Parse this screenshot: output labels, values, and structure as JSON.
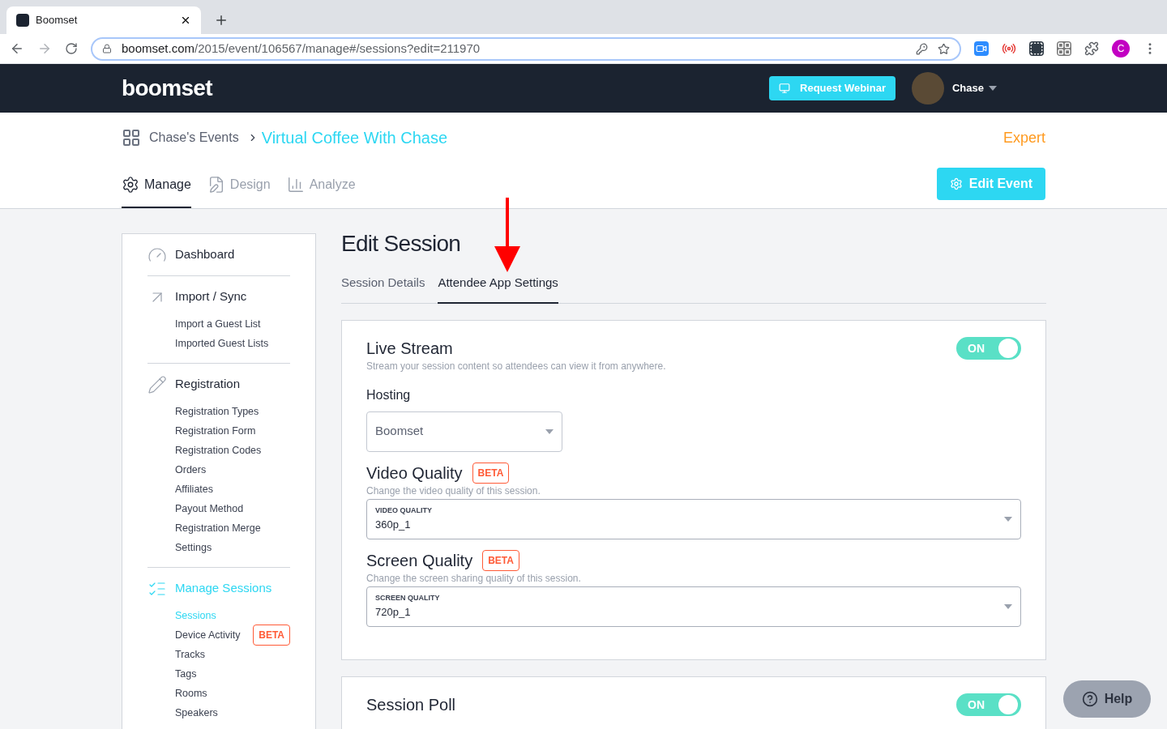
{
  "browser": {
    "tab_title": "Boomset",
    "url_host": "boomset.com",
    "url_path": "/2015/event/106567/manage#/sessions?edit=211970",
    "profile_initial": "C"
  },
  "navbar": {
    "logo": "boomset",
    "request_button": "Request Webinar",
    "user_name": "Chase"
  },
  "header": {
    "breadcrumb_parent": "Chase's Events",
    "breadcrumb_current": "Virtual Coffee With Chase",
    "plan": "Expert",
    "edit_button": "Edit Event",
    "tabs": [
      {
        "label": "Manage",
        "kind": "gear",
        "selected": true
      },
      {
        "label": "Design",
        "kind": "design",
        "selected": false
      },
      {
        "label": "Analyze",
        "kind": "chart",
        "selected": false
      }
    ]
  },
  "sidebar": {
    "sections": [
      {
        "title": "Dashboard",
        "kind": "dashboard",
        "selected": false
      },
      {
        "title": "Import / Sync",
        "kind": "import",
        "selected": false,
        "items": [
          {
            "label": "Import a Guest List",
            "selected": false
          },
          {
            "label": "Imported Guest Lists",
            "selected": false
          }
        ]
      },
      {
        "title": "Registration",
        "kind": "registration",
        "selected": false,
        "items": [
          {
            "label": "Registration Types",
            "selected": false
          },
          {
            "label": "Registration Form",
            "selected": false
          },
          {
            "label": "Registration Codes",
            "selected": false
          },
          {
            "label": "Orders",
            "selected": false
          },
          {
            "label": "Affiliates",
            "selected": false
          },
          {
            "label": "Payout Method",
            "selected": false
          },
          {
            "label": "Registration Merge",
            "selected": false
          },
          {
            "label": "Settings",
            "selected": false
          }
        ]
      },
      {
        "title": "Manage Sessions",
        "kind": "sessions",
        "selected": true,
        "items": [
          {
            "label": "Sessions",
            "selected": true
          },
          {
            "label": "Device Activity",
            "selected": false,
            "badge": "BETA"
          },
          {
            "label": "Tracks",
            "selected": false
          },
          {
            "label": "Tags",
            "selected": false
          },
          {
            "label": "Rooms",
            "selected": false
          },
          {
            "label": "Speakers",
            "selected": false
          }
        ]
      }
    ]
  },
  "main": {
    "title": "Edit Session",
    "tabs": [
      {
        "label": "Session Details",
        "selected": false
      },
      {
        "label": "Attendee App Settings",
        "selected": true
      }
    ],
    "cards": [
      {
        "title": "Live Stream",
        "description": "Stream your session content so attendees can view it from anywhere.",
        "toggle": {
          "on": true,
          "label": "ON"
        },
        "fields": [
          {
            "kind": "select",
            "label": "Hosting",
            "value": "Boomset"
          },
          {
            "kind": "labeled_select",
            "title": "Video Quality",
            "badge": "BETA",
            "description": "Change the video quality of this session.",
            "field_label": "VIDEO QUALITY",
            "value": "360p_1"
          },
          {
            "kind": "labeled_select",
            "title": "Screen Quality",
            "badge": "BETA",
            "description": "Change the screen sharing quality of this session.",
            "field_label": "SCREEN QUALITY",
            "value": "720p_1"
          }
        ]
      },
      {
        "title": "Session Poll",
        "toggle": {
          "on": true,
          "label": "ON"
        }
      }
    ]
  },
  "help_button": "Help"
}
